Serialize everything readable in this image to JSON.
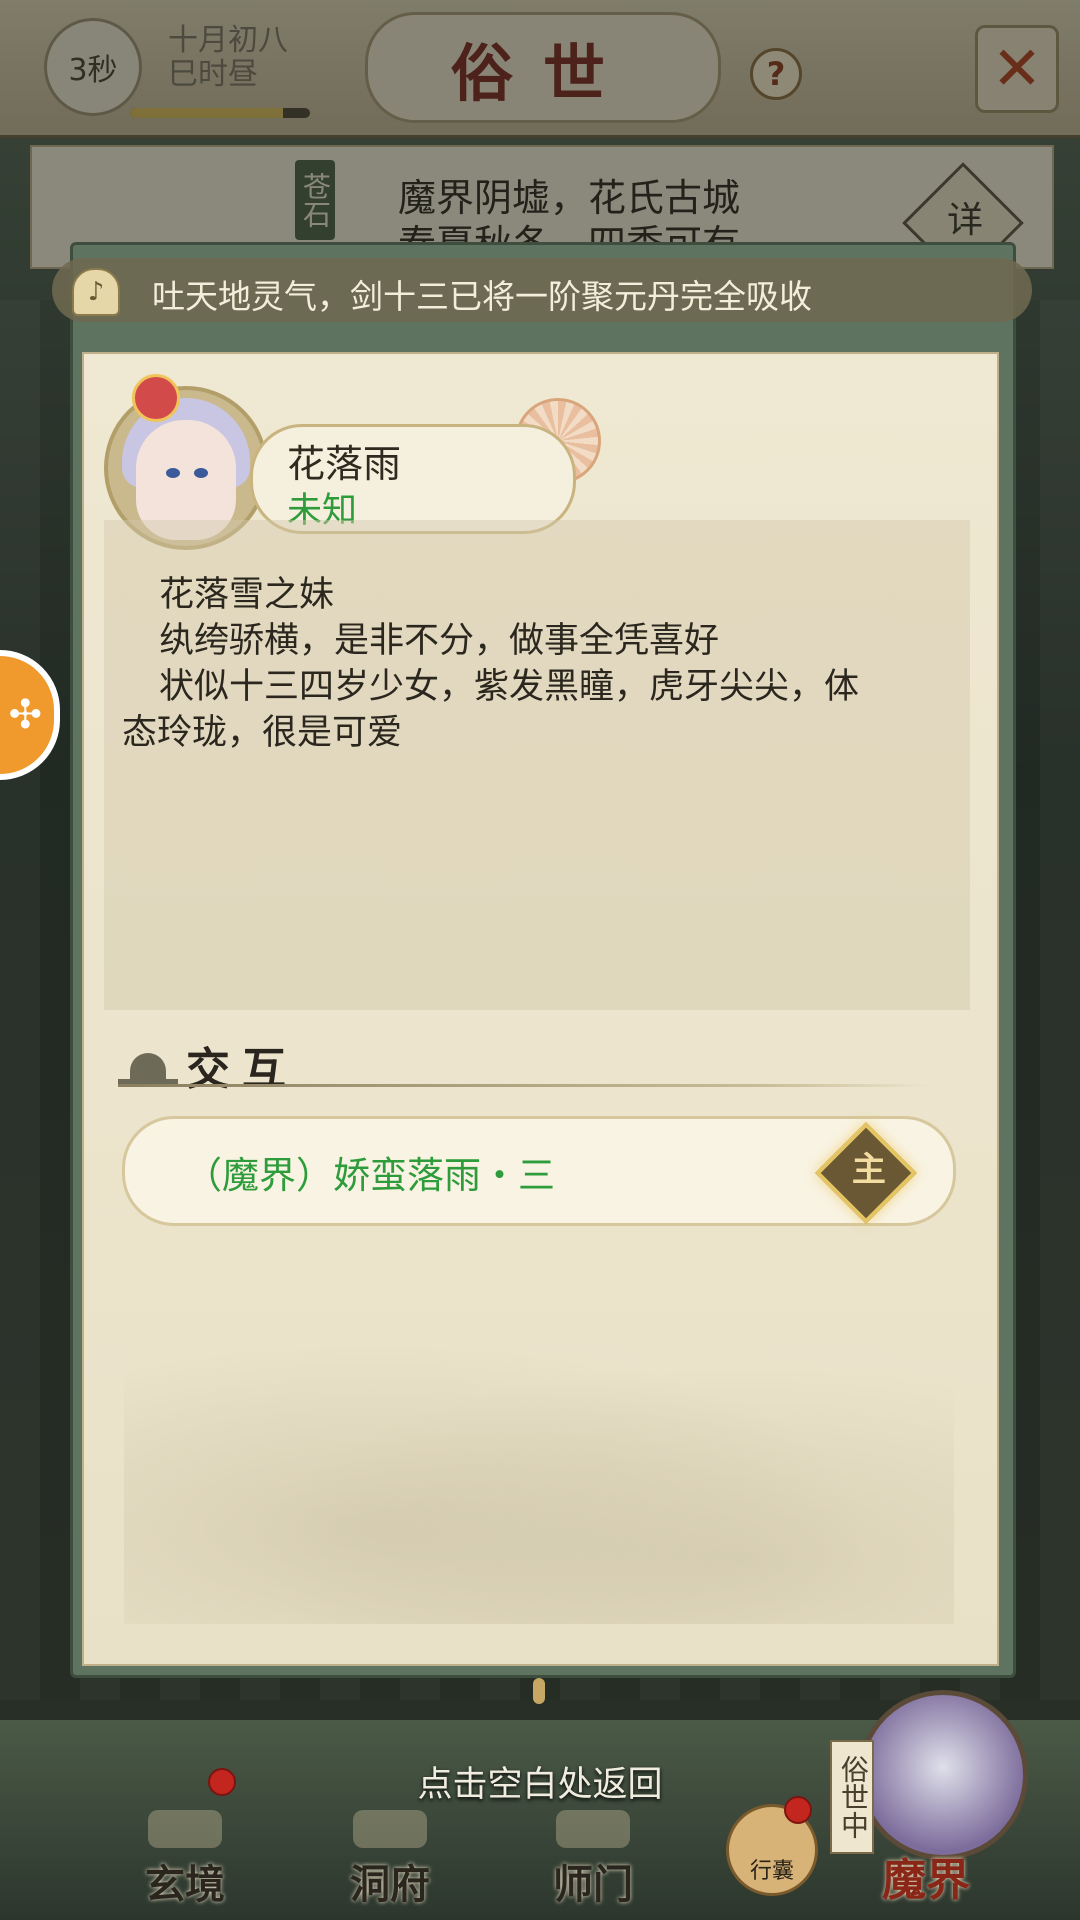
{
  "topbar": {
    "timer": "3秒",
    "date_line1": "十月初八",
    "date_line2": "巳时昼",
    "time_progress": 0.85,
    "title": "俗世",
    "help_icon": "?",
    "close_icon": "✕"
  },
  "location": {
    "tag": "苍石",
    "line1": "魔界阴墟，花氏古城",
    "line2": "春夏秋冬，四季可有",
    "detail_label": "详"
  },
  "notice": {
    "icon": "bell-icon",
    "text": "吐天地灵气，剑十三已将一阶聚元丹完全吸收"
  },
  "npc": {
    "name": "花落雨",
    "status": "未知",
    "description": [
      "花落雪之妹",
      "纨绔骄横，是非不分，做事全凭喜好",
      "状似十三四岁少女，紫发黑瞳，虎牙尖尖，体",
      "态玲珑，很是可爱"
    ]
  },
  "interaction": {
    "section_title": "交互",
    "tasks": [
      {
        "label": "（魔界）娇蛮落雨・三",
        "badge": "主"
      }
    ]
  },
  "float_button": {
    "icon": "gamepad-icon"
  },
  "bottom": {
    "hint": "点击空白处返回",
    "nav": [
      {
        "label": "玄境"
      },
      {
        "label": "洞府"
      },
      {
        "label": "师门"
      }
    ],
    "bag_label": "行囊",
    "world_tag": "俗世中",
    "world_name": "魔界"
  }
}
